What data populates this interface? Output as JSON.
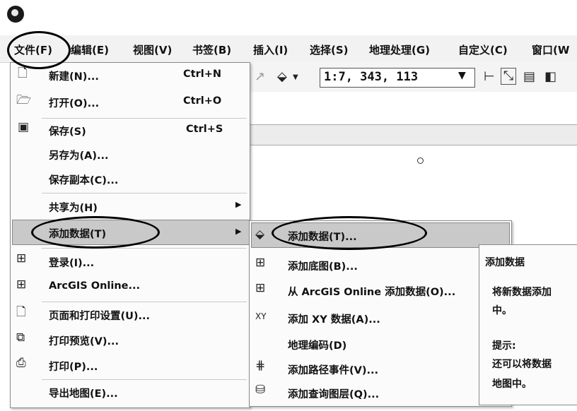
{
  "menubar": {
    "items": [
      "文件(F)",
      "编辑(E)",
      "视图(V)",
      "书签(B)",
      "插入(I)",
      "选择(S)",
      "地理处理(G)",
      "自定义(C)",
      "窗口(W"
    ]
  },
  "toolbar": {
    "scale": "1:7, 343, 113"
  },
  "file_menu": {
    "items": [
      {
        "label": "新建(N)...",
        "shortcut": "Ctrl+N"
      },
      {
        "label": "打开(O)...",
        "shortcut": "Ctrl+O"
      },
      {
        "label": "保存(S)",
        "shortcut": "Ctrl+S"
      },
      {
        "label": "另存为(A)..."
      },
      {
        "label": "保存副本(C)..."
      },
      {
        "label": "共享为(H)"
      },
      {
        "label": "添加数据(T)"
      },
      {
        "label": "登录(I)..."
      },
      {
        "label": "ArcGIS Online..."
      },
      {
        "label": "页面和打印设置(U)..."
      },
      {
        "label": "打印预览(V)..."
      },
      {
        "label": "打印(P)..."
      },
      {
        "label": "导出地图(E)..."
      }
    ]
  },
  "sub_menu": {
    "items": [
      {
        "label": "添加数据(T)..."
      },
      {
        "label": "添加底图(B)..."
      },
      {
        "label": "从 ArcGIS Online 添加数据(O)..."
      },
      {
        "label": "添加 XY 数据(A)..."
      },
      {
        "label": "地理编码(D)"
      },
      {
        "label": "添加路径事件(V)..."
      },
      {
        "label": "添加查询图层(Q)..."
      }
    ]
  },
  "tooltip": {
    "title": "添加数据",
    "line1": "将新数据添加",
    "line2": "中。",
    "tip_label": "提示:",
    "line3": "还可以将数据",
    "line4": "地图中。"
  },
  "icons": [
    "app-logo-icon",
    "new-doc-icon",
    "open-folder-icon",
    "save-disk-icon",
    "grid-icon",
    "add-data-icon",
    "xy-data-icon",
    "route-event-icon",
    "query-layer-icon",
    "page-setup-icon",
    "print-preview-icon",
    "printer-icon"
  ]
}
